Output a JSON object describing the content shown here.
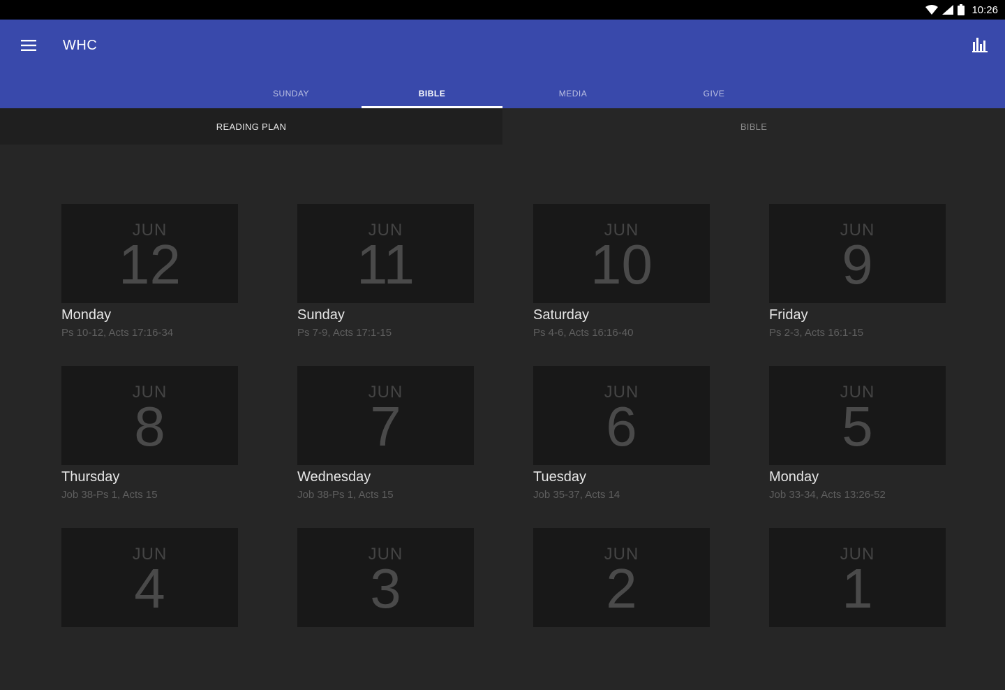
{
  "status_bar": {
    "time": "10:26"
  },
  "app_bar": {
    "title": "WHC"
  },
  "tabs": [
    {
      "label": "SUNDAY"
    },
    {
      "label": "BIBLE"
    },
    {
      "label": "MEDIA"
    },
    {
      "label": "GIVE"
    }
  ],
  "sub_tabs": [
    {
      "label": "READING PLAN"
    },
    {
      "label": "BIBLE"
    }
  ],
  "plan": [
    {
      "month": "JUN",
      "day": "12",
      "weekday": "Monday",
      "readings": "Ps 10-12, Acts 17:16-34"
    },
    {
      "month": "JUN",
      "day": "11",
      "weekday": "Sunday",
      "readings": "Ps 7-9, Acts 17:1-15"
    },
    {
      "month": "JUN",
      "day": "10",
      "weekday": "Saturday",
      "readings": "Ps 4-6, Acts 16:16-40"
    },
    {
      "month": "JUN",
      "day": "9",
      "weekday": "Friday",
      "readings": "Ps 2-3, Acts 16:1-15"
    },
    {
      "month": "JUN",
      "day": "8",
      "weekday": "Thursday",
      "readings": "Job 38-Ps 1, Acts 15"
    },
    {
      "month": "JUN",
      "day": "7",
      "weekday": "Wednesday",
      "readings": "Job 38-Ps 1, Acts 15"
    },
    {
      "month": "JUN",
      "day": "6",
      "weekday": "Tuesday",
      "readings": "Job 35-37, Acts 14"
    },
    {
      "month": "JUN",
      "day": "5",
      "weekday": "Monday",
      "readings": "Job 33-34, Acts 13:26-52"
    },
    {
      "month": "JUN",
      "day": "4",
      "weekday": "",
      "readings": ""
    },
    {
      "month": "JUN",
      "day": "3",
      "weekday": "",
      "readings": ""
    },
    {
      "month": "JUN",
      "day": "2",
      "weekday": "",
      "readings": ""
    },
    {
      "month": "JUN",
      "day": "1",
      "weekday": "",
      "readings": ""
    }
  ],
  "colors": {
    "app_bar": "#3949ab",
    "background": "#262626",
    "tile": "#181818"
  }
}
